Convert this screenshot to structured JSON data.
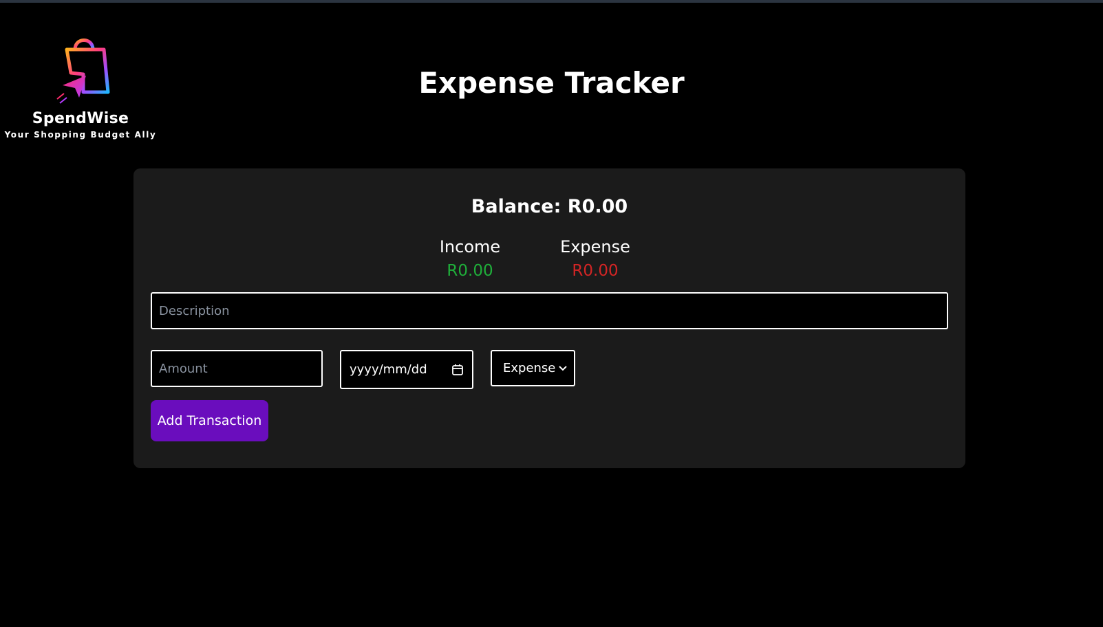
{
  "brand": {
    "name": "SpendWise",
    "tagline": "Your Shopping Budget Ally",
    "logo_icon": "shopping-bag-cursor-icon"
  },
  "page": {
    "title": "Expense Tracker"
  },
  "summary": {
    "balance_text": "Balance: R0.00",
    "income_label": "Income",
    "income_value": "R0.00",
    "expense_label": "Expense",
    "expense_value": "R0.00",
    "income_color": "#1fae3a",
    "expense_color": "#d42525"
  },
  "form": {
    "description_placeholder": "Description",
    "amount_placeholder": "Amount",
    "date_placeholder": "yyyy/mm/dd",
    "type_selected": "Expense",
    "add_button_label": "Add Transaction"
  },
  "colors": {
    "background": "#000000",
    "card": "#1b1b1b",
    "accent": "#6a0dbd"
  }
}
